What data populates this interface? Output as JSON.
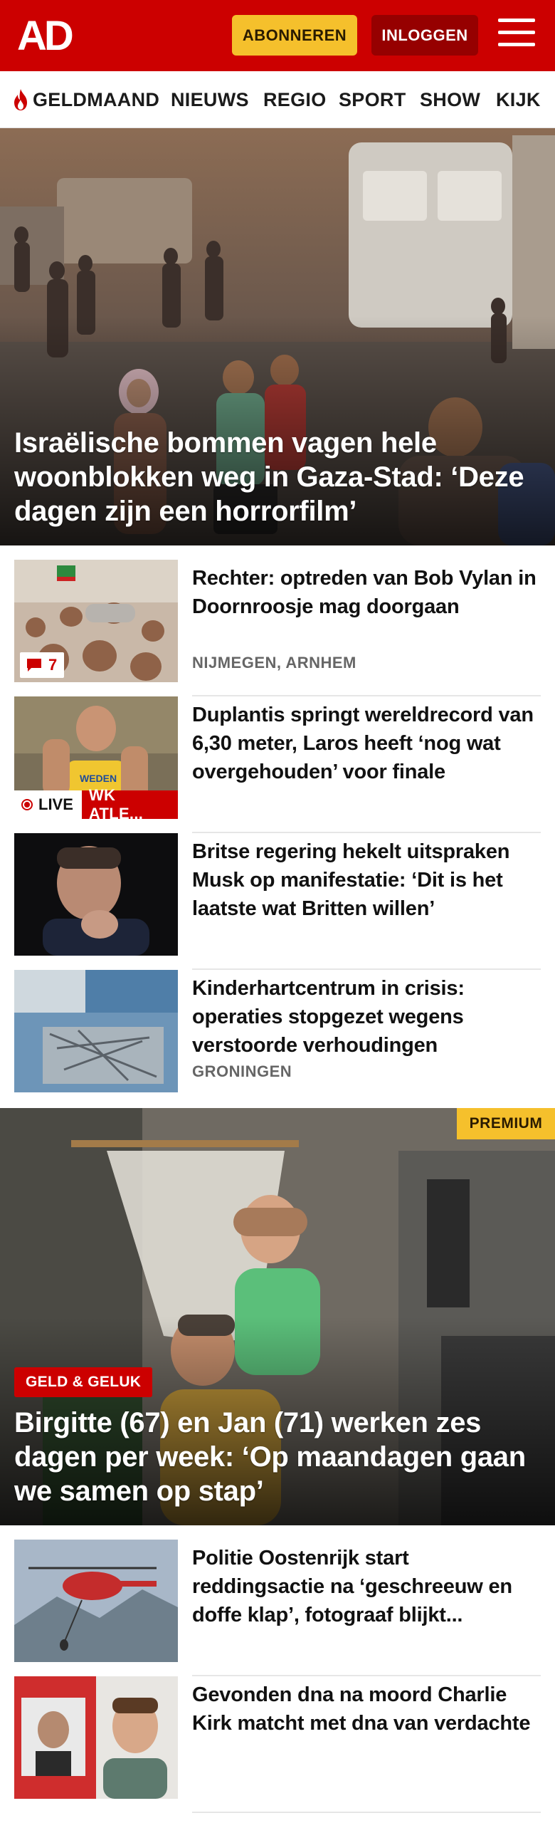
{
  "header": {
    "logo_text": "AD",
    "subscribe_label": "ABONNEREN",
    "login_label": "INLOGGEN",
    "menu_icon": "hamburger-menu-icon",
    "brand_color": "#cc0000",
    "accent_color": "#f5c02c"
  },
  "nav": {
    "items": [
      {
        "label": "GELDMAAND",
        "icon": "flame-icon"
      },
      {
        "label": "NIEUWS"
      },
      {
        "label": "REGIO"
      },
      {
        "label": "SPORT"
      },
      {
        "label": "SHOW"
      },
      {
        "label": "KIJK"
      }
    ]
  },
  "hero": {
    "title": "Israëlische bommen vagen hele woonblokken weg in Gaza-Stad: ‘Deze dagen zijn een horrorfilm’"
  },
  "articles": [
    {
      "title": "Rechter: optreden van Bob Vylan in Doornroosje mag doorgaan",
      "meta": "NIJMEGEN, ARNHEM",
      "comments": "7"
    },
    {
      "title": "Duplantis springt wereldrecord van 6,30 meter, Laros heeft ‘nog wat overgehouden’ voor finale",
      "live_label": "LIVE",
      "tag": "WK ATLE..."
    },
    {
      "title": "Britse regering hekelt uitspraken Musk op manifestatie: ‘Dit is het laatste wat Britten willen’"
    },
    {
      "title": "Kinderhartcentrum in crisis: operaties stopgezet wegens verstoorde verhoudingen",
      "meta": "GRONINGEN"
    }
  ],
  "feature": {
    "premium_label": "PREMIUM",
    "category": "GELD & GELUK",
    "title": "Birgitte (67) en Jan (71) werken zes dagen per week: ‘Op maandagen gaan we samen op stap’"
  },
  "articles2": [
    {
      "title": "Politie Oostenrijk start reddingsactie na ‘geschreeuw en doffe klap’, fotograaf blijkt..."
    },
    {
      "title": "Gevonden dna na moord Charlie Kirk matcht met dna van verdachte"
    }
  ]
}
